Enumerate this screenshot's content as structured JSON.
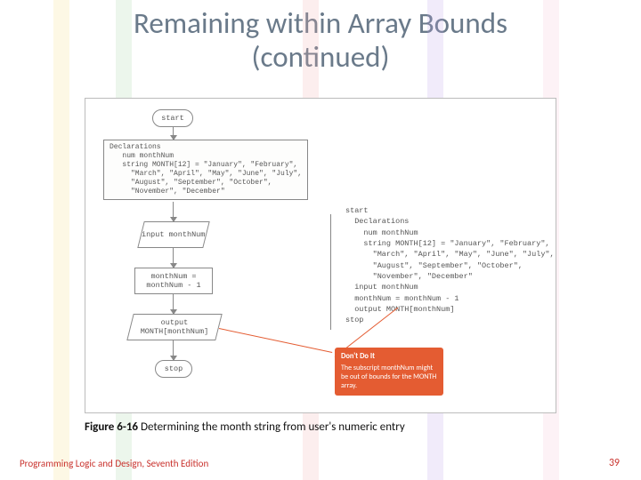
{
  "title_line1": "Remaining within Array Bounds",
  "title_line2": "(continued)",
  "flowchart": {
    "start": "start",
    "declarations": "Declarations\n   num monthNum\n   string MONTH[12] = \"January\", \"February\",\n     \"March\", \"April\", \"May\", \"June\", \"July\",\n     \"August\", \"September\", \"October\",\n     \"November\", \"December\"",
    "input": "input\nmonthNum",
    "assign": "monthNum =\nmonthNum - 1",
    "output": "output\nMONTH[monthNum]",
    "stop": "stop"
  },
  "pseudocode": "start\n  Declarations\n    num monthNum\n    string MONTH[12] = \"January\", \"February\",\n      \"March\", \"April\", \"May\", \"June\", \"July\",\n      \"August\", \"September\", \"October\",\n      \"November\", \"December\"\n  input monthNum\n  monthNum = monthNum - 1\n  output MONTH[monthNum]\nstop",
  "callout": {
    "heading": "Don't Do It",
    "body": "The subscript monthNum might be out of bounds for the MONTH array."
  },
  "caption_strong": "Figure 6-16",
  "caption_rest": " Determining the month string from user's numeric entry",
  "footer_left": "Programming Logic and Design, Seventh Edition",
  "footer_right": "39"
}
